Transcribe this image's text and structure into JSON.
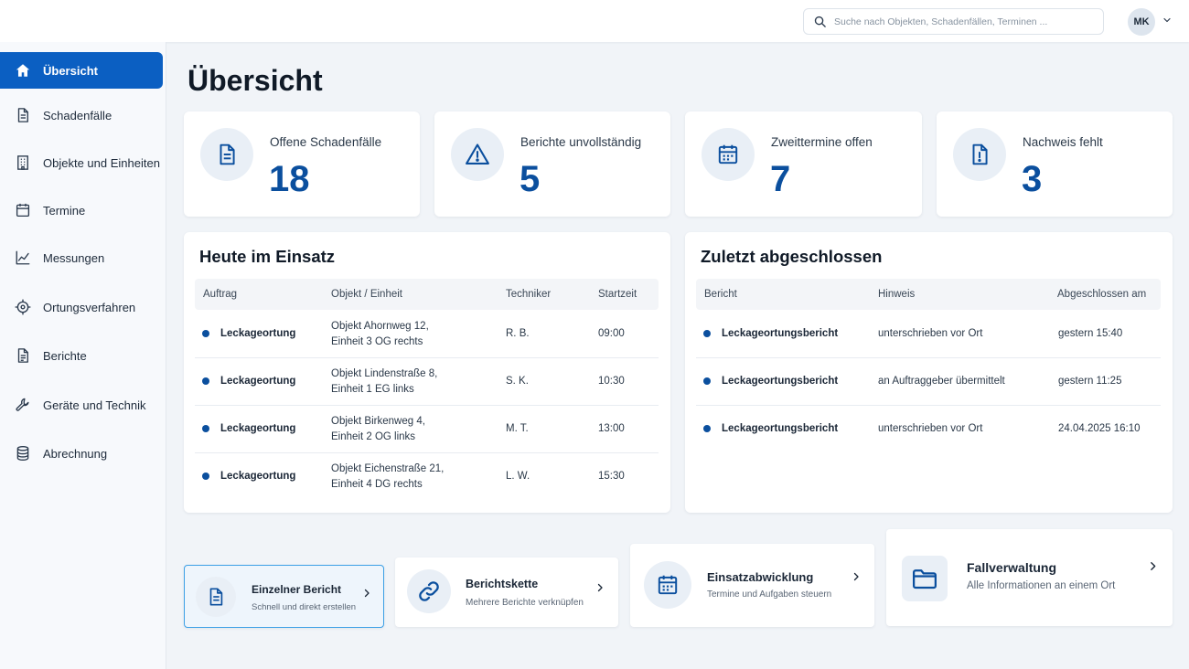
{
  "search": {
    "placeholder": "Suche nach Objekten, Schadenfällen, Terminen ..."
  },
  "user": {
    "initials": "MK"
  },
  "sidebar": {
    "items": [
      {
        "label": "Übersicht",
        "icon": "home-icon",
        "active": true
      },
      {
        "label": "Schadenfälle",
        "icon": "document-icon"
      },
      {
        "label": "Objekte und Einheiten",
        "icon": "building-icon"
      },
      {
        "label": "Termine",
        "icon": "calendar-icon"
      },
      {
        "label": "Messungen",
        "icon": "chart-line-icon"
      },
      {
        "label": "Ortungsverfahren",
        "icon": "crosshair-icon"
      },
      {
        "label": "Berichte",
        "icon": "report-icon"
      },
      {
        "label": "Geräte und Technik",
        "icon": "wrench-icon"
      },
      {
        "label": "Abrechnung",
        "icon": "database-icon"
      }
    ]
  },
  "page": {
    "title": "Übersicht"
  },
  "kpis": [
    {
      "label": "Offene Schadenfälle",
      "value": "18",
      "icon": "document-icon"
    },
    {
      "label": "Berichte unvollständig",
      "value": "5",
      "icon": "warning-icon"
    },
    {
      "label": "Zweittermine offen",
      "value": "7",
      "icon": "calendar-icon"
    },
    {
      "label": "Nachweis fehlt",
      "value": "3",
      "icon": "alert-document-icon"
    }
  ],
  "today": {
    "title": "Heute im Einsatz",
    "columns": [
      "Auftrag",
      "Objekt / Einheit",
      "Techniker",
      "Startzeit"
    ],
    "rows": [
      {
        "auftrag": "Leckageortung",
        "objekt1": "Objekt Ahornweg 12,",
        "objekt2": "Einheit 3 OG rechts",
        "techniker": "R. B.",
        "start": "09:00"
      },
      {
        "auftrag": "Leckageortung",
        "objekt1": "Objekt Lindenstraße 8,",
        "objekt2": "Einheit 1 EG links",
        "techniker": "S. K.",
        "start": "10:30"
      },
      {
        "auftrag": "Leckageortung",
        "objekt1": "Objekt Birkenweg 4,",
        "objekt2": "Einheit 2 OG links",
        "techniker": "M. T.",
        "start": "13:00"
      },
      {
        "auftrag": "Leckageortung",
        "objekt1": "Objekt Eichenstraße 21,",
        "objekt2": "Einheit 4 DG rechts",
        "techniker": "L. W.",
        "start": "15:30"
      }
    ]
  },
  "recent": {
    "title": "Zuletzt abgeschlossen",
    "columns": [
      "Bericht",
      "Hinweis",
      "Abgeschlossen am"
    ],
    "rows": [
      {
        "bericht": "Leckageortungsbericht",
        "hinweis": "unterschrieben vor Ort",
        "datum": "gestern 15:40"
      },
      {
        "bericht": "Leckageortungsbericht",
        "hinweis": "an Auftraggeber übermittelt",
        "datum": "gestern 11:25"
      },
      {
        "bericht": "Leckageortungsbericht",
        "hinweis": "unterschrieben vor Ort",
        "datum": "24.04.2025 16:10"
      }
    ]
  },
  "actions": [
    {
      "title": "Einzelner Bericht",
      "subtitle": "Schnell und direkt erstellen",
      "icon": "document-icon",
      "selected": true
    },
    {
      "title": "Berichtskette",
      "subtitle": "Mehrere Berichte verknüpfen",
      "icon": "link-icon"
    },
    {
      "title": "Einsatzabwicklung",
      "subtitle": "Termine und Aufgaben steuern",
      "icon": "calendar-icon"
    },
    {
      "title": "Fallverwaltung",
      "subtitle": "Alle Informationen an einem Ort",
      "icon": "folder-icon"
    }
  ],
  "colors": {
    "accent": "#0b5fc2",
    "kpi_value": "#0b4f9e",
    "selected_border": "#3da0e6"
  }
}
